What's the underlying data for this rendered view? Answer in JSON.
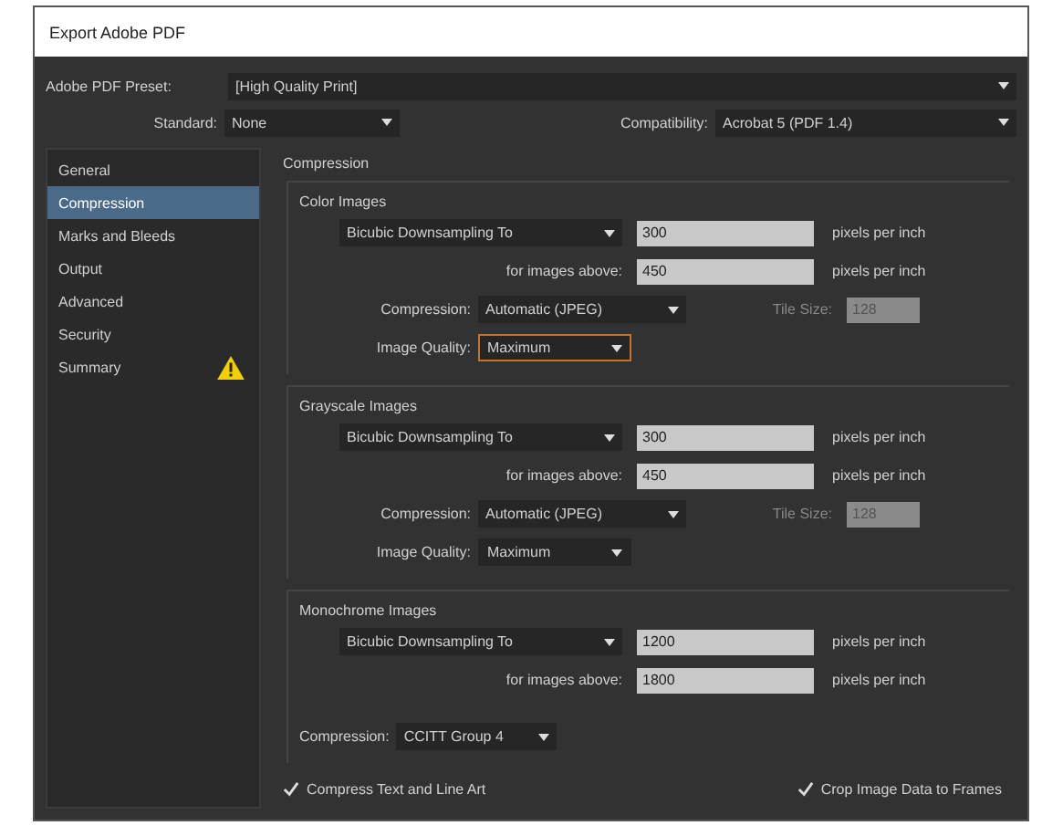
{
  "window": {
    "title": "Export Adobe PDF"
  },
  "preset": {
    "label": "Adobe PDF Preset:",
    "value": "[High Quality Print]"
  },
  "standard": {
    "label": "Standard:",
    "value": "None"
  },
  "compatibility": {
    "label": "Compatibility:",
    "value": "Acrobat 5 (PDF 1.4)"
  },
  "sidebar": {
    "items": [
      {
        "label": "General",
        "selected": false,
        "warning": false
      },
      {
        "label": "Compression",
        "selected": true,
        "warning": false
      },
      {
        "label": "Marks and Bleeds",
        "selected": false,
        "warning": false
      },
      {
        "label": "Output",
        "selected": false,
        "warning": false
      },
      {
        "label": "Advanced",
        "selected": false,
        "warning": false
      },
      {
        "label": "Security",
        "selected": false,
        "warning": false
      },
      {
        "label": "Summary",
        "selected": false,
        "warning": true
      }
    ]
  },
  "section_title": "Compression",
  "groups": [
    {
      "kind": "full",
      "title": "Color Images",
      "downsampling": "Bicubic Downsampling To",
      "resolution": "300",
      "unit": "pixels per inch",
      "above_label": "for images above:",
      "above": "450",
      "above_unit": "pixels per inch",
      "compression_label": "Compression:",
      "compression": "Automatic (JPEG)",
      "tile_label": "Tile Size:",
      "tile": "128",
      "tile_disabled": true,
      "quality_label": "Image Quality:",
      "quality": "Maximum",
      "quality_focused": true
    },
    {
      "kind": "full",
      "title": "Grayscale Images",
      "downsampling": "Bicubic Downsampling To",
      "resolution": "300",
      "unit": "pixels per inch",
      "above_label": "for images above:",
      "above": "450",
      "above_unit": "pixels per inch",
      "compression_label": "Compression:",
      "compression": "Automatic (JPEG)",
      "tile_label": "Tile Size:",
      "tile": "128",
      "tile_disabled": true,
      "quality_label": "Image Quality:",
      "quality": "Maximum",
      "quality_focused": false
    },
    {
      "kind": "mono",
      "title": "Monochrome Images",
      "downsampling": "Bicubic Downsampling To",
      "resolution": "1200",
      "unit": "pixels per inch",
      "above_label": "for images above:",
      "above": "1800",
      "above_unit": "pixels per inch",
      "compression_label": "Compression:",
      "compression": "CCITT Group 4"
    }
  ],
  "options": [
    {
      "label": "Compress Text and Line Art",
      "checked": true
    },
    {
      "label": "Crop Image Data to Frames",
      "checked": true
    }
  ]
}
